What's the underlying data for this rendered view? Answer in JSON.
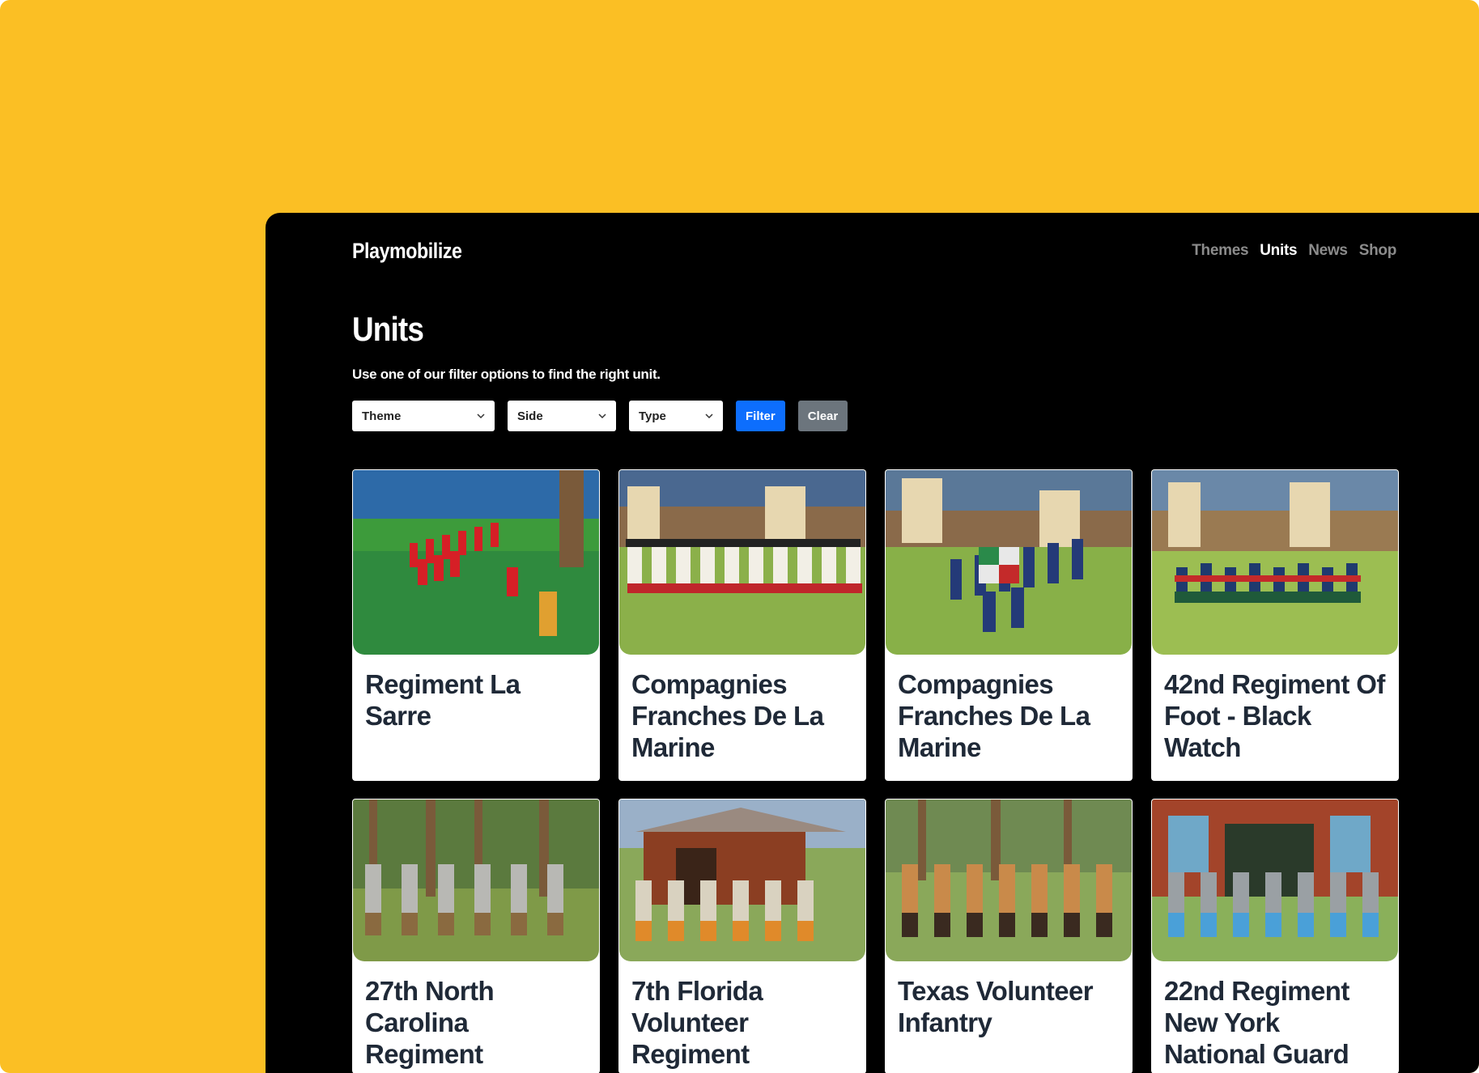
{
  "brand": "Playmobilize",
  "nav": {
    "items": [
      {
        "label": "Themes",
        "active": false
      },
      {
        "label": "Units",
        "active": true
      },
      {
        "label": "News",
        "active": false
      },
      {
        "label": "Shop",
        "active": false
      }
    ]
  },
  "page": {
    "title": "Units",
    "subtitle": "Use one of our filter options to find the right unit."
  },
  "filters": {
    "theme": "Theme",
    "side": "Side",
    "type": "Type",
    "filter_label": "Filter",
    "clear_label": "Clear"
  },
  "colors": {
    "accent_yellow": "#fbbf24",
    "primary_blue": "#0d6efd",
    "secondary_gray": "#6c757d"
  },
  "cards": [
    {
      "title": "Regiment La Sarre",
      "image": "redcoat-column-photo"
    },
    {
      "title": "Compagnies Franches De La Marine",
      "image": "fort-infantry-photo"
    },
    {
      "title": "Compagnies Franches De La Marine",
      "image": "fort-flag-column-photo"
    },
    {
      "title": "42nd Regiment Of Foot - Black Watch",
      "image": "highlanders-fort-photo"
    },
    {
      "title": "27th North Carolina Regiment",
      "image": "grey-infantry-forest-photo"
    },
    {
      "title": "7th Florida Volunteer Regiment",
      "image": "barn-infantry-photo"
    },
    {
      "title": "Texas Volunteer Infantry",
      "image": "texas-infantry-photo"
    },
    {
      "title": "22nd Regiment New York National Guard",
      "image": "red-barn-infantry-photo"
    }
  ]
}
